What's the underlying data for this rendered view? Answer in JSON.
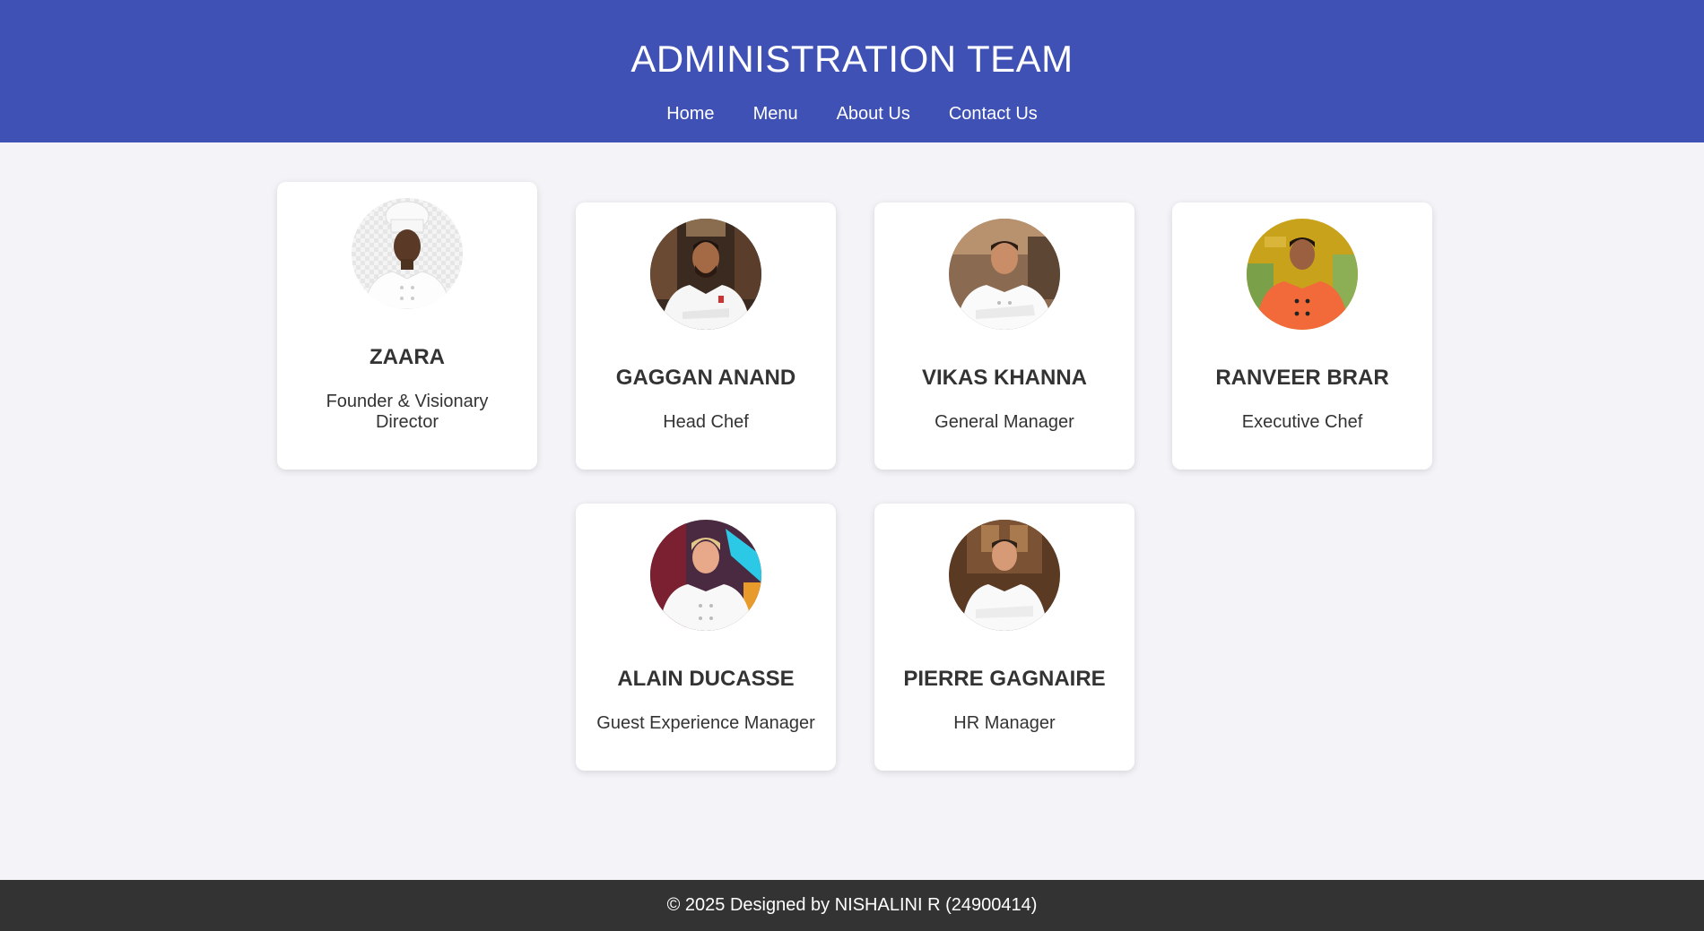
{
  "header": {
    "title": "ADMINISTRATION TEAM",
    "nav": [
      "Home",
      "Menu",
      "About Us",
      "Contact Us"
    ]
  },
  "team": [
    {
      "name": "ZAARA",
      "role": "Founder & Visionary Director",
      "photo": "chef-portrait-icon"
    },
    {
      "name": "GAGGAN ANAND",
      "role": "Head Chef",
      "photo": "chef-portrait-icon"
    },
    {
      "name": "VIKAS KHANNA",
      "role": "General Manager",
      "photo": "chef-portrait-icon"
    },
    {
      "name": "RANVEER BRAR",
      "role": "Executive Chef",
      "photo": "chef-portrait-icon"
    },
    {
      "name": "ALAIN DUCASSE",
      "role": "Guest Experience Manager",
      "photo": "chef-portrait-icon"
    },
    {
      "name": "PIERRE GAGNAIRE",
      "role": "HR Manager",
      "photo": "chef-portrait-icon"
    }
  ],
  "colors": {
    "header_bg": "#3f51b5",
    "page_bg": "#f4f4f8",
    "footer_bg": "#333333"
  },
  "footer": {
    "text": "© 2025 Designed by NISHALINI R (24900414)"
  }
}
